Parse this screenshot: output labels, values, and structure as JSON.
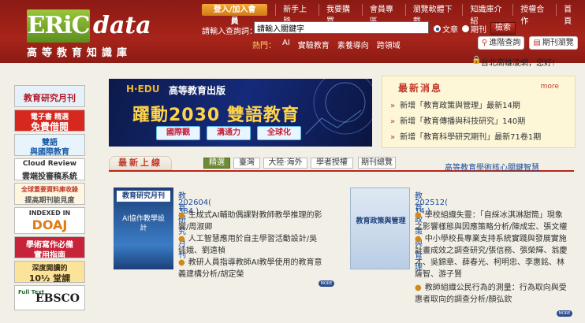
{
  "header": {
    "logo_text": "ERiC",
    "logo_suffix": "data",
    "logo_subtitle": "高等教育知識庫",
    "join_label": "登入/加入會員",
    "nav": [
      "新手上路",
      "我要購買",
      "會員專區",
      "瀏覽軟體下載",
      "知識庫介紹",
      "授權合作",
      "首頁"
    ],
    "search_label": "請輸入查詢詞：",
    "search_value": "請輸入關鍵字",
    "radio_article": "文章",
    "radio_periodical": "期刊",
    "search_button": "檢索",
    "hot_label": "熱門：",
    "hot_items": [
      "AI",
      "實驗教育",
      "素養導向",
      "跨領域"
    ],
    "advanced_search": "進階查詢",
    "periodical_browse": "期刊瀏覽",
    "user_greeting": "台北高雄凌網，您好!"
  },
  "sidebar": {
    "items": [
      {
        "line1": "教育研究月刊",
        "line2": "",
        "bg": "#e6f0f8",
        "fg": "#b21a2a"
      },
      {
        "line1": "電子書 精選",
        "line2": "免費借閱",
        "bg": "#d6281f",
        "fg": "#ffffff"
      },
      {
        "line1": "雙語",
        "line2": "與國際教育",
        "bg": "#e8f4fb",
        "fg": "#1b5ca8"
      },
      {
        "line1": "Cloud Review",
        "line2": "雲端投審稿系統",
        "bg": "#ffffff",
        "fg": "#333333"
      },
      {
        "line1": "全球重要資料庫收錄",
        "line2": "提高期刊能見度",
        "bg": "#fff6e0",
        "fg": "#c0392b"
      },
      {
        "line1": "INDEXED IN",
        "line2": "DOAJ",
        "bg": "#ffffff",
        "fg": "#e07a14"
      },
      {
        "line1": "學術寫作必備",
        "line2": "實用指南",
        "bg": "#c7243a",
        "fg": "#ffffff"
      },
      {
        "line1": "深度閱讀的",
        "line2": "10½ 堂課",
        "bg": "#fbe39a",
        "fg": "#3a2a10"
      },
      {
        "line1": "Full Text",
        "line2": "EBSCO",
        "bg": "#ffffff",
        "fg": "#1c1c1c"
      }
    ]
  },
  "promo": {
    "brand_logo": "H·EDU",
    "brand": "高等教育出版",
    "title": "躍動2030 雙語教育",
    "tags": [
      "國際觀",
      "溝通力",
      "全球化"
    ]
  },
  "news": {
    "title": "最新消息",
    "more": "more",
    "items": [
      "新增「教育政策與管理」最新14期",
      "新增「教育傳播與科技研究」140期",
      "新增「教育科學研究期刊」最新71卷1期"
    ]
  },
  "tabs": {
    "title": "最新上線",
    "items": [
      "精選",
      "臺灣",
      "大陸·海外",
      "學者授權"
    ],
    "periodical": "期刊總覽",
    "note": "高等教育學術核心關鍵智慧"
  },
  "journals": [
    {
      "name": "教育研究月刊",
      "issue": "202604( 384 )",
      "cover_title": "教育研究月刊",
      "cover_sub": "AI協作教學設計",
      "items": [
        "生成式AI輔助偶課對教師教學推理的影響/周淑卿",
        "人工智慧應用於自主學習活動設計/吳佳娥、劉遠楨",
        "教研人員指導教師AI教學使用的教育意義建構分析/胡定榮"
      ],
      "more": "MORE"
    },
    {
      "name": "教育政策與管理",
      "issue": "202512( 14 )",
      "cover_title": "教育政策與管理",
      "cover_sub": "",
      "items": [
        "學校組織失靈：「自綵冰淇淋甜筒」現象之影響樣態與因應策略分析/陳成宏、張文權",
        "中小學校長專業支持系統實踐與發展實施計畫成效之調查研究/張信務、張榮輝、翁慶才、吳錦章、薛春光、柯明忠、李惠銘、林薩智、游子賢",
        "教師組織公民行為的測量：行為取向與受惠者取向的調查分析/顏弘欽"
      ],
      "more": "MORE"
    }
  ]
}
